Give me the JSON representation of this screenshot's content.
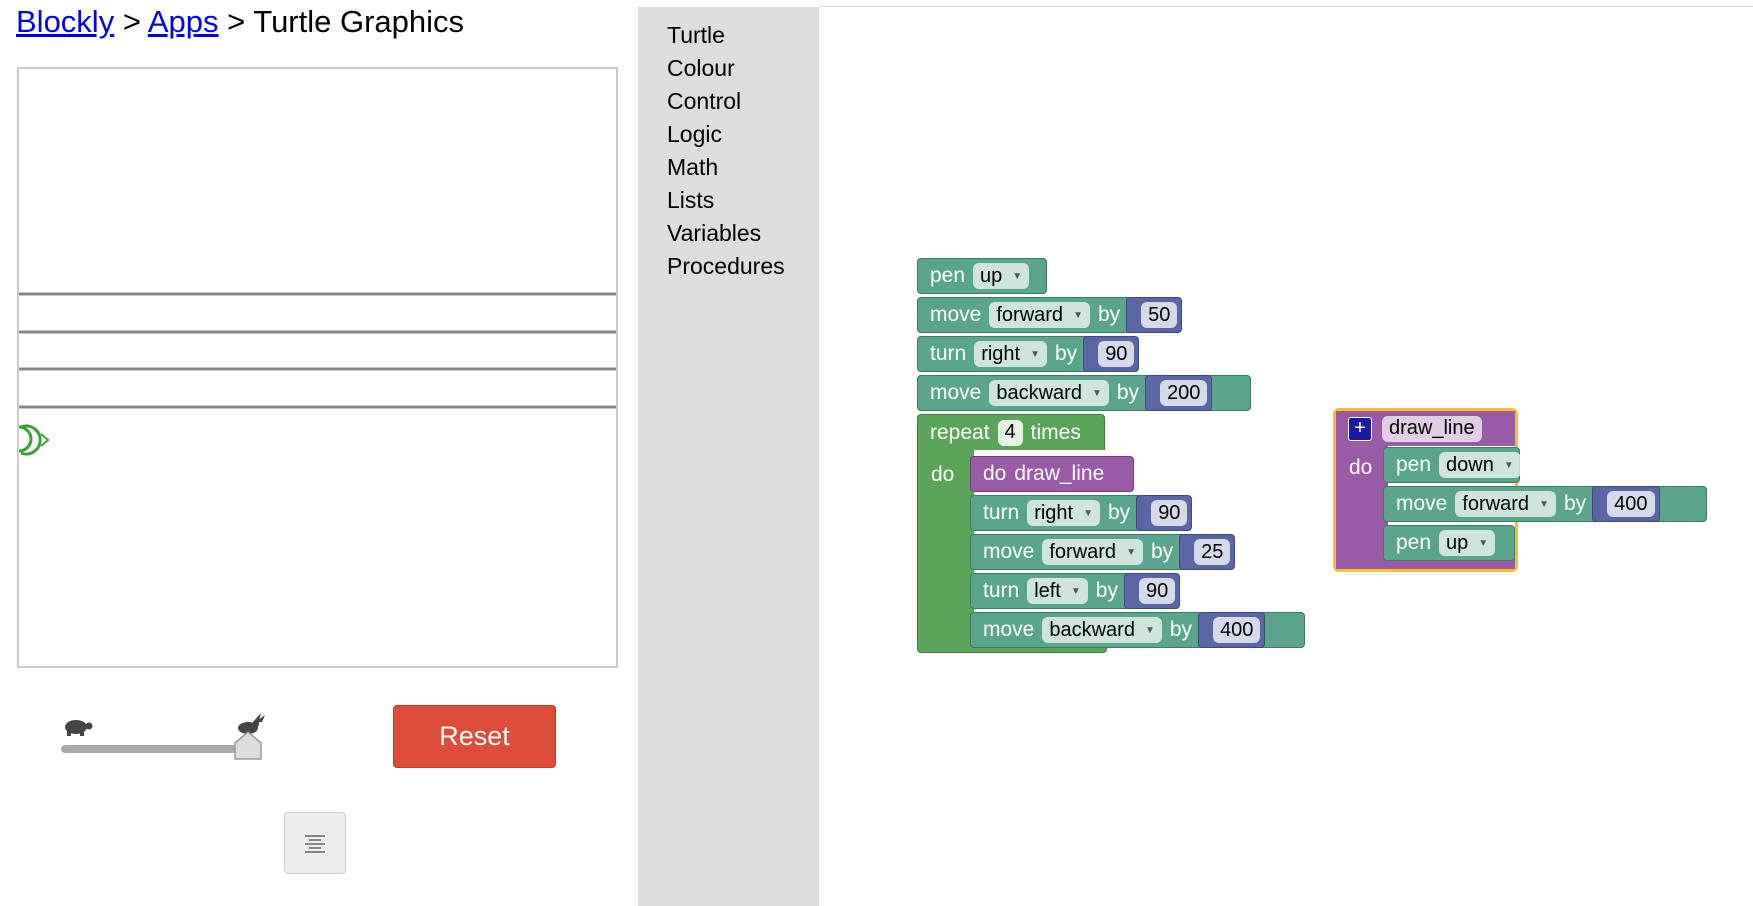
{
  "breadcrumb": {
    "link1": "Blockly",
    "sep1": " > ",
    "link2": "Apps",
    "sep2": " > ",
    "title": "Turtle Graphics"
  },
  "controls": {
    "reset_label": "Reset",
    "speed_value": 1.0
  },
  "toolbox": {
    "categories": [
      "Turtle",
      "Colour",
      "Control",
      "Logic",
      "Math",
      "Lists",
      "Variables",
      "Procedures"
    ]
  },
  "blocks": {
    "pen": "pen",
    "move": "move",
    "turn": "turn",
    "by": "by",
    "repeat": "repeat",
    "times": "times",
    "do": "do",
    "up": "up",
    "down": "down",
    "forward": "forward",
    "backward": "backward",
    "right": "right",
    "left": "left",
    "n50": "50",
    "n90": "90",
    "n200": "200",
    "n4": "4",
    "n25": "25",
    "n400": "400",
    "proc_name": "draw_line",
    "call_do": "do",
    "def_do": "do"
  },
  "colors": {
    "turtle": "#5ba58c",
    "loop": "#5ba55b",
    "procedure": "#995ba5",
    "math": "#5b67a5",
    "reset": "#dd4b39",
    "selection": "#fbc02d",
    "turtle_icon": "#3aa03a"
  }
}
